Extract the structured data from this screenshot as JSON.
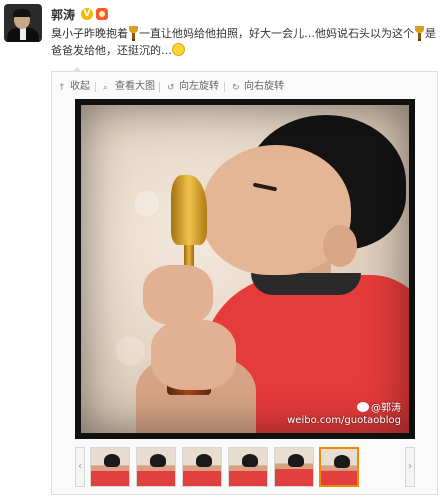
{
  "user": {
    "name": "郭涛"
  },
  "post": {
    "text_part1": "臭小子昨晚抱着",
    "text_part2": "一直让他妈给他拍照，好大一会儿…他妈说石头以为这个",
    "text_part3": "是爸爸发给他，还挺沉的…"
  },
  "toolbar": {
    "collapse": "收起",
    "view_large": "查看大图",
    "rotate_left": "向左旋转",
    "rotate_right": "向右旋转"
  },
  "photo": {
    "watermark_user": "@郭涛",
    "watermark_url": "weibo.com/guotaoblog"
  },
  "thumbnails": {
    "count": 6,
    "active_index": 5
  },
  "colors": {
    "verified_badge": "#f6b800",
    "member_badge": "#ff5a2c",
    "active_thumb_border": "#f28a00"
  }
}
